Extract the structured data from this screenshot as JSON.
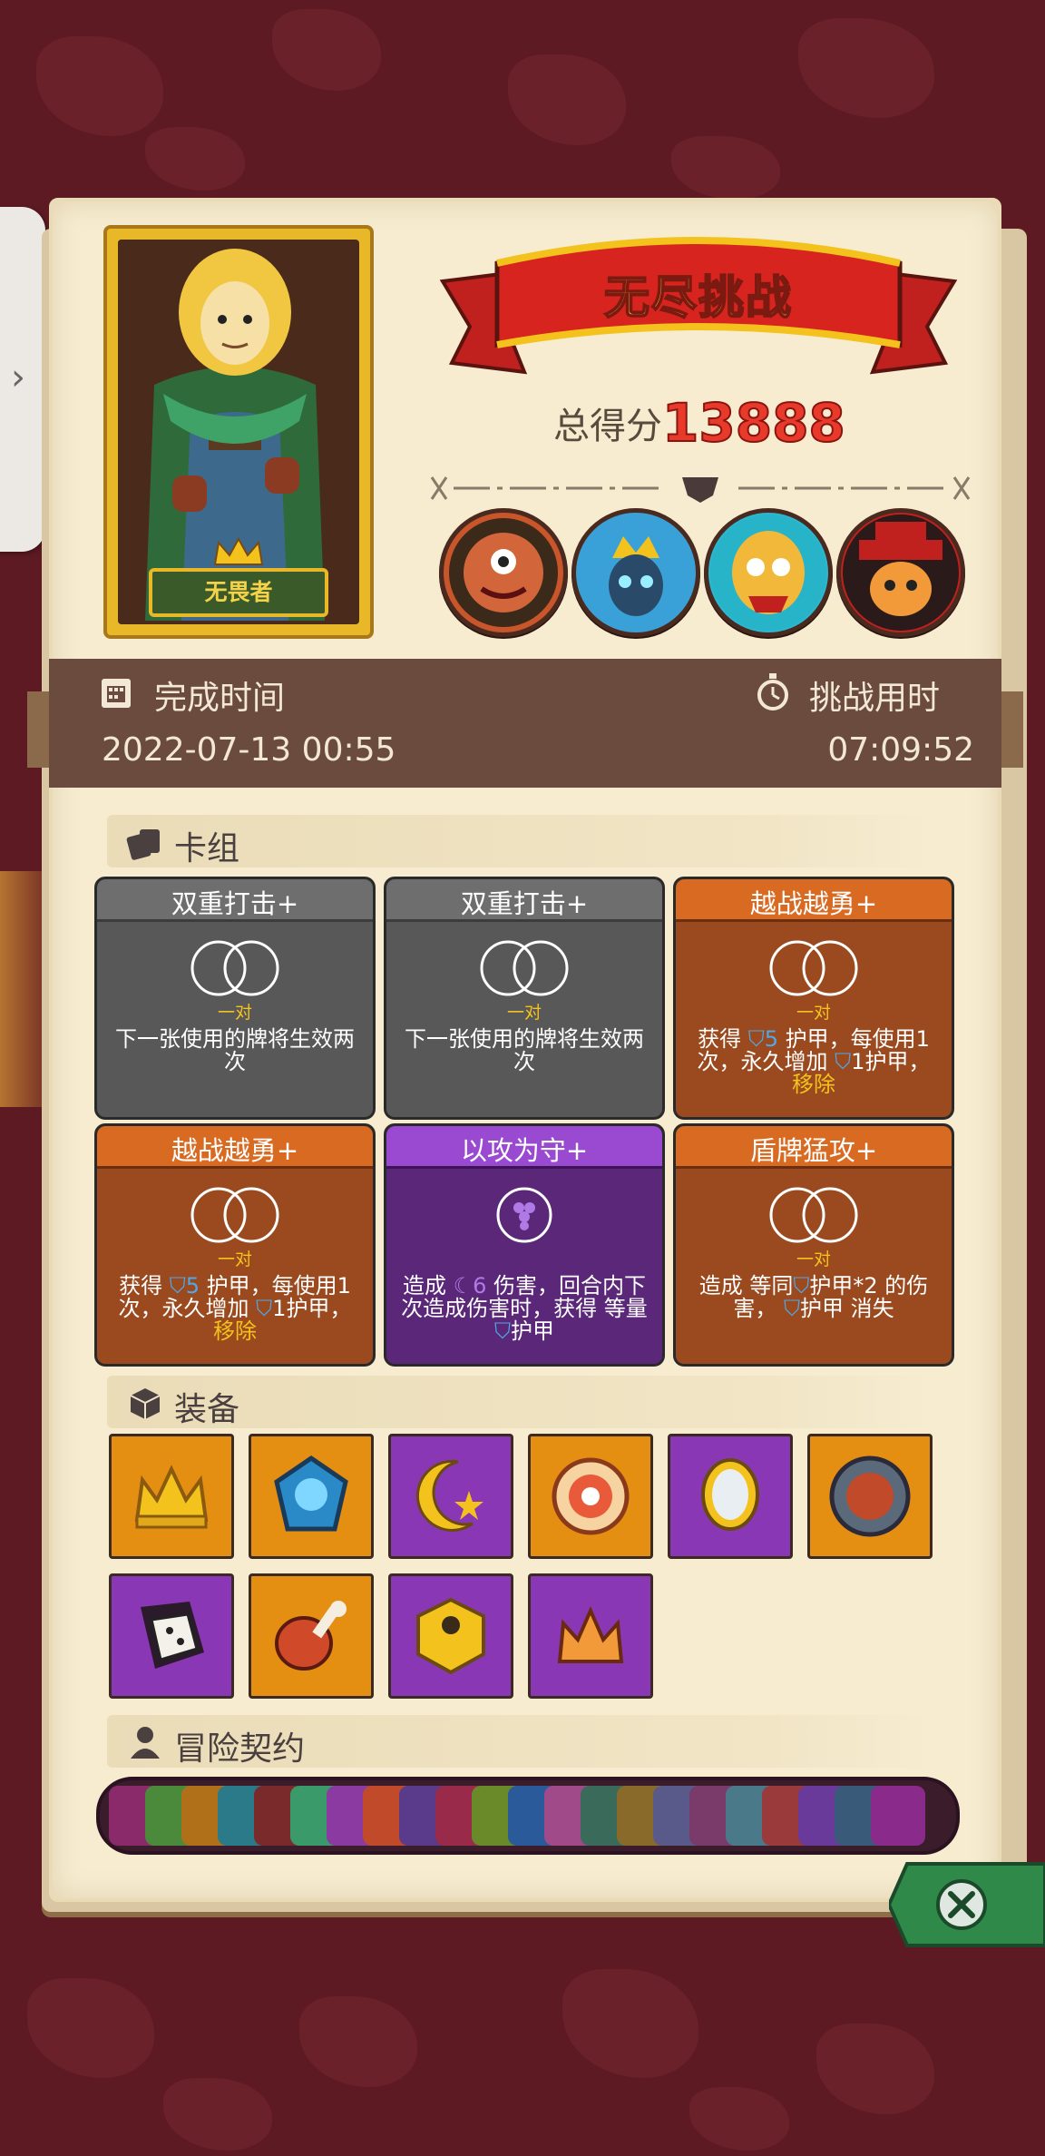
{
  "mode_title": "无尽挑战",
  "score": {
    "label": "总得分",
    "value": "13888"
  },
  "hero": {
    "title": "无畏者"
  },
  "completion": {
    "label": "完成时间",
    "value": "2022-07-13 00:55"
  },
  "duration": {
    "label": "挑战用时",
    "value": "07:09:52"
  },
  "sections": {
    "deck": "卡组",
    "equipment": "装备",
    "contract": "冒险契约"
  },
  "cards": [
    {
      "name": "双重打击+",
      "pair": "一对",
      "style": "grey",
      "desc": [
        "下一张使用的牌将生效两次"
      ]
    },
    {
      "name": "双重打击+",
      "pair": "一对",
      "style": "grey",
      "desc": [
        "下一张使用的牌将生效两次"
      ]
    },
    {
      "name": "越战越勇+",
      "pair": "一对",
      "style": "orange",
      "desc": [
        "获得",
        "5",
        "护甲，每使用1次，永久增加",
        "1护甲，",
        "移除"
      ]
    },
    {
      "name": "越战越勇+",
      "pair": "一对",
      "style": "orange",
      "desc": [
        "获得",
        "5",
        "护甲，每使用1次，永久增加",
        "1护甲，",
        "移除"
      ]
    },
    {
      "name": "以攻为守+",
      "pair": "",
      "style": "purple",
      "desc": [
        "造成",
        "6",
        "伤害，回合内下次造成伤害时，获得 等量",
        "护甲"
      ]
    },
    {
      "name": "盾牌猛攻+",
      "pair": "一对",
      "style": "orange",
      "desc": [
        "造成 等同",
        "护甲*2 的伤害，",
        "护甲 消失"
      ]
    }
  ],
  "equipment": [
    {
      "icon": "gold-crown-icon",
      "bg": "orange"
    },
    {
      "icon": "blue-gem-amulet-icon",
      "bg": "orange"
    },
    {
      "icon": "moon-star-icon",
      "bg": "purple"
    },
    {
      "icon": "eye-medallion-icon",
      "bg": "orange"
    },
    {
      "icon": "ornate-mirror-icon",
      "bg": "purple"
    },
    {
      "icon": "round-shield-icon",
      "bg": "orange"
    },
    {
      "icon": "cracked-dice-icon",
      "bg": "purple"
    },
    {
      "icon": "meat-leg-icon",
      "bg": "orange"
    },
    {
      "icon": "golden-dice-icon",
      "bg": "purple"
    },
    {
      "icon": "flame-crown-icon",
      "bg": "purple"
    }
  ],
  "colors": {
    "accent_red": "#e83a2a",
    "panel": "#f7ecd0",
    "timebar": "#6b4b3e",
    "gold": "#f3c21d"
  }
}
